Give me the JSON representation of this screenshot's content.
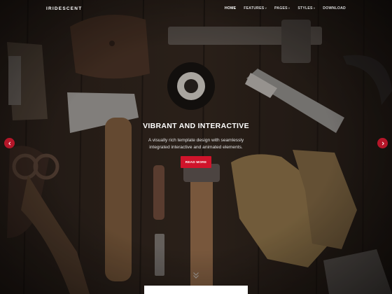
{
  "brand": "IRIDESCENT",
  "nav": [
    {
      "label": "HOME",
      "active": true,
      "dropdown": false
    },
    {
      "label": "FEATURES",
      "active": false,
      "dropdown": true
    },
    {
      "label": "PAGES",
      "active": false,
      "dropdown": true
    },
    {
      "label": "STYLES",
      "active": false,
      "dropdown": true
    },
    {
      "label": "DOWNLOAD",
      "active": false,
      "dropdown": false
    }
  ],
  "hero": {
    "title": "VIBRANT AND INTERACTIVE",
    "subtitle_line1": "A visually rich template design with seamlessly",
    "subtitle_line2": "integrated interactive and animated elements.",
    "button_label": "READ MORE"
  },
  "icons": {
    "prev": "chevron-left-icon",
    "next": "chevron-right-icon",
    "scroll": "chevron-down-icon"
  },
  "colors": {
    "accent": "#d0142b",
    "background": "#241c17"
  }
}
